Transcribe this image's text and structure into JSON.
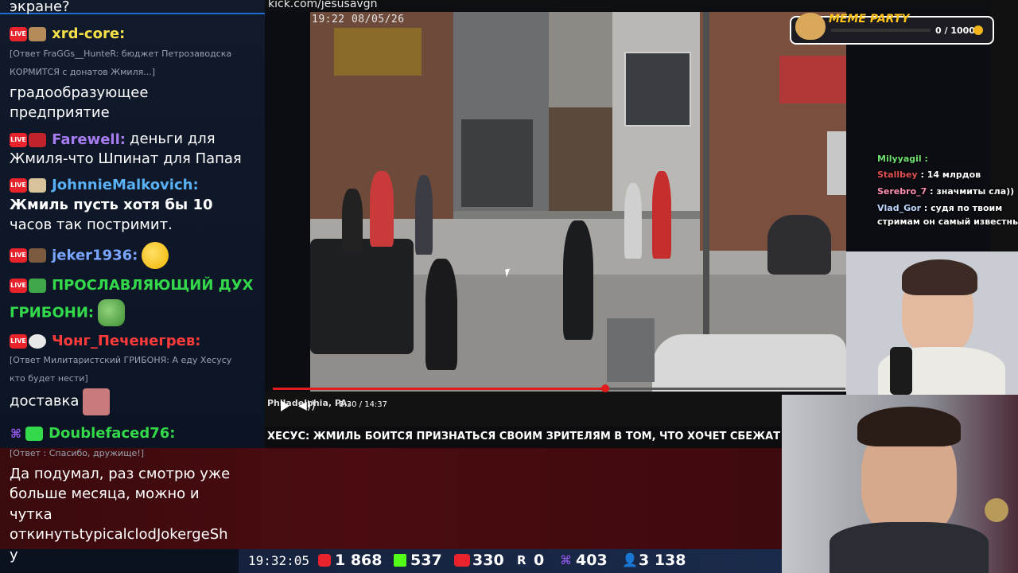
{
  "browser": {
    "url": "kick.com/jesusavgn"
  },
  "chat": {
    "messages": [
      {
        "nick": "",
        "text": "экране?"
      },
      {
        "nick": "xrd-core:",
        "nick_color": "#f5e04a",
        "reply": "[Ответ FraGGs__HunteR: бюджет Петрозаводска",
        "reply2": "КОРМИТСЯ с донатов Жмиля...]",
        "text1": "градообразующее",
        "text2": "предприятие"
      },
      {
        "nick": "Farewell:",
        "nick_color": "#a77cf0",
        "text1": "деньги для",
        "text2": "Жмиля-что Шпинат для Папая"
      },
      {
        "nick": "JohnnieMalkovich:",
        "nick_color": "#5ab0f5",
        "text1": "Жмиль пусть хотя бы 10",
        "text2": "часов так постримит."
      },
      {
        "nick": "jeker1936:",
        "nick_color": "#7aa6ff"
      },
      {
        "nick1": "ПРОСЛАВЛЯЮЩИЙ ДУХ",
        "nick2": "ГРИБОНИ:",
        "nick_color": "#33d94a"
      },
      {
        "nick": "Чонг_Печенегрев:",
        "nick_color": "#ff3b3b",
        "reply": "[Ответ Милитаристский ГРИБОНЯ: А еду Хесусу",
        "reply2": "кто будет нести]",
        "text1": "доставка"
      },
      {
        "nick": "Doublefaced76:",
        "nick_color": "#33d94a",
        "reply": "[Ответ : Спасибо, дружище!]",
        "text1": "Да подумал, раз смотрю уже",
        "text2": "больше месяца, можно и",
        "text3": "чутка",
        "text4": "откинутьtypicalclodJokergeSh",
        "text5": "у"
      }
    ]
  },
  "video": {
    "timestamp": "19:22 08/05/26",
    "current_time": "8:30",
    "duration": "14:37",
    "progress": 0.581,
    "caption": "Philadelphia, PA."
  },
  "ticker": {
    "text": "ХЕСУС: ЖМИЛЬ БОИТСЯ ПРИЗНАТЬСЯ СВОИМ ЗРИТЕЛЯМ В ТОМ, ЧТО ХОЧЕТ СБЕЖАТЬ ИЗ РФ"
  },
  "status_bar": {
    "clock": "19:32:05",
    "youtube": "1 868",
    "kick": "537",
    "vklive": "330",
    "rutube": "0",
    "twitch": "403",
    "viewers": "3 138"
  },
  "meme_party": {
    "title": "MEME PARTY",
    "count": "0 / 1000"
  },
  "mini_chat": [
    {
      "nick": "Milyyagil :",
      "text": ""
    },
    {
      "nick": "Stallbey",
      "text": " : 14 млрдов"
    },
    {
      "nick": "Serebro_7",
      "text": " : значмиты сла))"
    },
    {
      "nick": "Vlad_Gor",
      "text": " : судя по твоим"
    },
    {
      "nick": "",
      "text": "стримам он самый известный)"
    }
  ],
  "colors": {
    "live_red": "#e8232b",
    "progress_red": "#e21b1b",
    "kick_green": "#53fc18",
    "twitch_purple": "#9b5df5",
    "meme_gold": "#ffc21a"
  }
}
